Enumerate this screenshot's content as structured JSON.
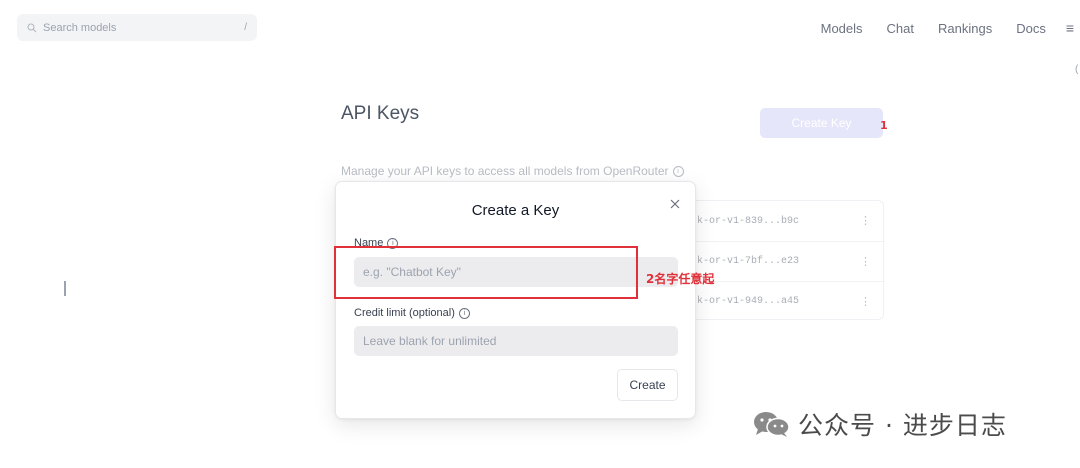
{
  "header": {
    "search": {
      "placeholder": "Search models",
      "shortcut": "/"
    },
    "nav": [
      "Models",
      "Chat",
      "Rankings",
      "Docs"
    ],
    "menu_icon": "≡"
  },
  "page": {
    "title": "API Keys",
    "create_key_label": "Create Key",
    "subtitle": "Manage your API keys to access all models from OpenRouter",
    "keys": [
      {
        "id": "k-or-v1-839...b9c"
      },
      {
        "id": "k-or-v1-7bf...e23"
      },
      {
        "id": "k-or-v1-949...a45"
      }
    ]
  },
  "modal": {
    "title": "Create a Key",
    "name_label": "Name",
    "name_placeholder": "e.g. \"Chatbot Key\"",
    "credit_label": "Credit limit (optional)",
    "credit_placeholder": "Leave blank for unlimited",
    "create_label": "Create"
  },
  "annotations": {
    "step1": "1",
    "step2": "2名字任意起"
  },
  "watermark": {
    "text": "公众号 · 进步日志"
  },
  "colors": {
    "annotation_red": "#e0313a",
    "create_key_bg": "#e6e6fb",
    "input_bg": "#ececee"
  },
  "icons": [
    "search-icon",
    "menu-icon",
    "info-icon",
    "close-icon",
    "kebab-icon",
    "wechat-icon"
  ]
}
